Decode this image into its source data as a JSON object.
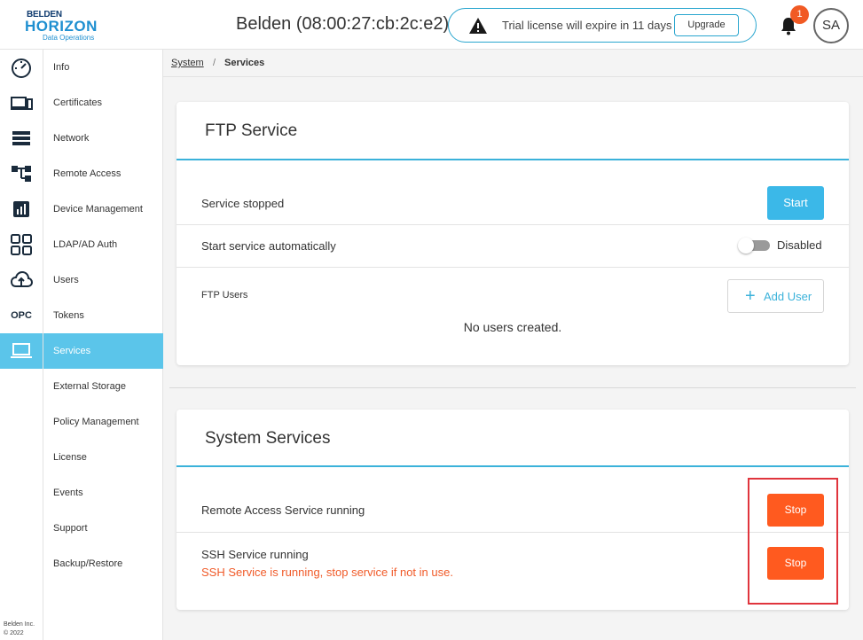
{
  "header": {
    "logo_line1": "BELDEN",
    "logo_line2": "HORIZON",
    "logo_line3": "Data Operations",
    "device_title": "Belden (08:00:27:cb:2c:e2)",
    "license_message": "Trial license will expire in 11 days",
    "upgrade_label": "Upgrade",
    "notification_count": "1",
    "avatar_initials": "SA"
  },
  "rail": {
    "icons": [
      "dashboard-icon",
      "devices-icon",
      "list-icon",
      "hierarchy-icon",
      "chart-icon",
      "apps-icon",
      "cloud-upload-icon",
      "opc-icon",
      "laptop-icon"
    ],
    "opc_label": "OPC",
    "active_index": 8,
    "footer_company": "Belden Inc.",
    "footer_copyright": "© 2022"
  },
  "subnav": {
    "items": [
      {
        "label": "Info"
      },
      {
        "label": "Certificates"
      },
      {
        "label": "Network"
      },
      {
        "label": "Remote Access"
      },
      {
        "label": "Device Management"
      },
      {
        "label": "LDAP/AD Auth"
      },
      {
        "label": "Users"
      },
      {
        "label": "Tokens"
      },
      {
        "label": "Services"
      },
      {
        "label": "External Storage"
      },
      {
        "label": "Policy Management"
      },
      {
        "label": "License"
      },
      {
        "label": "Events"
      },
      {
        "label": "Support"
      },
      {
        "label": "Backup/Restore"
      }
    ],
    "active_index": 8
  },
  "breadcrumb": {
    "parent": "System",
    "separator": "/",
    "current": "Services"
  },
  "ftp": {
    "title": "FTP Service",
    "status_text": "Service stopped",
    "start_label": "Start",
    "auto_start_label": "Start service automatically",
    "auto_start_state": "Disabled",
    "users_label": "FTP Users",
    "add_user_label": "Add User",
    "empty_text": "No users created."
  },
  "system_services": {
    "title": "System Services",
    "remote_access_text": "Remote Access Service running",
    "remote_access_stop": "Stop",
    "ssh_text": "SSH Service running",
    "ssh_warning": "SSH Service is running, stop service if not in use.",
    "ssh_stop": "Stop"
  },
  "colors": {
    "accent": "#3bb2da",
    "active_nav": "#5bc5ea",
    "stop": "#ff5a1f",
    "warning_text": "#f05a28",
    "badge": "#f15a24",
    "highlight": "#e0353d"
  }
}
